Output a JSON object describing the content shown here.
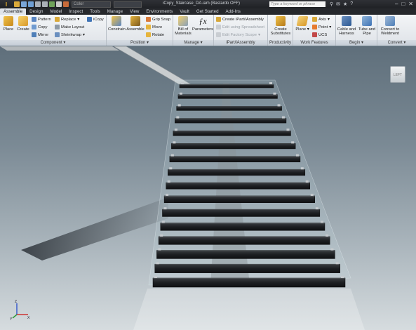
{
  "titlebar": {
    "app_letter": "I",
    "style_dropdown": "Color",
    "document_title": "iCopy_Staircase_DA.iam (Bastardo OFF)",
    "search_placeholder": "Type a keyword or phrase"
  },
  "tabs": [
    {
      "label": "Assemble",
      "active": true
    },
    {
      "label": "Design",
      "active": false
    },
    {
      "label": "Model",
      "active": false
    },
    {
      "label": "Inspect",
      "active": false
    },
    {
      "label": "Tools",
      "active": false
    },
    {
      "label": "Manage",
      "active": false
    },
    {
      "label": "View",
      "active": false
    },
    {
      "label": "Environments",
      "active": false
    },
    {
      "label": "Vault",
      "active": false
    },
    {
      "label": "Get Started",
      "active": false
    },
    {
      "label": "Add-Ins",
      "active": false
    }
  ],
  "ribbon": {
    "component": {
      "label": "Component",
      "place": "Place",
      "create": "Create",
      "pattern": "Pattern",
      "copy": "Copy",
      "mirror": "Mirror",
      "replace": "Replace",
      "make_layout": "Make Layout",
      "shrinkwrap": "Shrinkwrap",
      "icopy": "iCopy"
    },
    "position": {
      "label": "Position",
      "constrain": "Constrain",
      "assemble": "Assemble",
      "grip_snap": "Grip Snap",
      "move": "Move",
      "rotate": "Rotate"
    },
    "manage": {
      "label": "Manage",
      "bill_of_materials_1": "Bill of",
      "bill_of_materials_2": "Materials",
      "parameters": "Parameters"
    },
    "ipart": {
      "label": "iPart/iAssembly",
      "create": "Create iPart/iAssembly",
      "edit_spreadsheet": "Edit using Spreadsheet",
      "edit_factory": "Edit Factory Scope"
    },
    "productivity": {
      "label": "Productivity",
      "create_substitutes_1": "Create",
      "create_substitutes_2": "Substitutes"
    },
    "work_features": {
      "label": "Work Features",
      "plane": "Plane",
      "axis": "Axis",
      "point": "Point",
      "ucs": "UCS"
    },
    "begin": {
      "label": "Begin",
      "cable_1": "Cable and",
      "cable_2": "Harness",
      "tube_1": "Tube and",
      "tube_2": "Pipe"
    },
    "convert": {
      "label": "Convert",
      "weldment_1": "Convert to",
      "weldment_2": "Weldment"
    }
  },
  "viewport": {
    "viewcube_face": "LEFT",
    "triad_labels": [
      "Z",
      "X",
      "Y"
    ],
    "step_count": 16
  },
  "colors": {
    "accent": "#e8b02a",
    "step": "#1d1f22",
    "glass": "#cfe3ea"
  }
}
